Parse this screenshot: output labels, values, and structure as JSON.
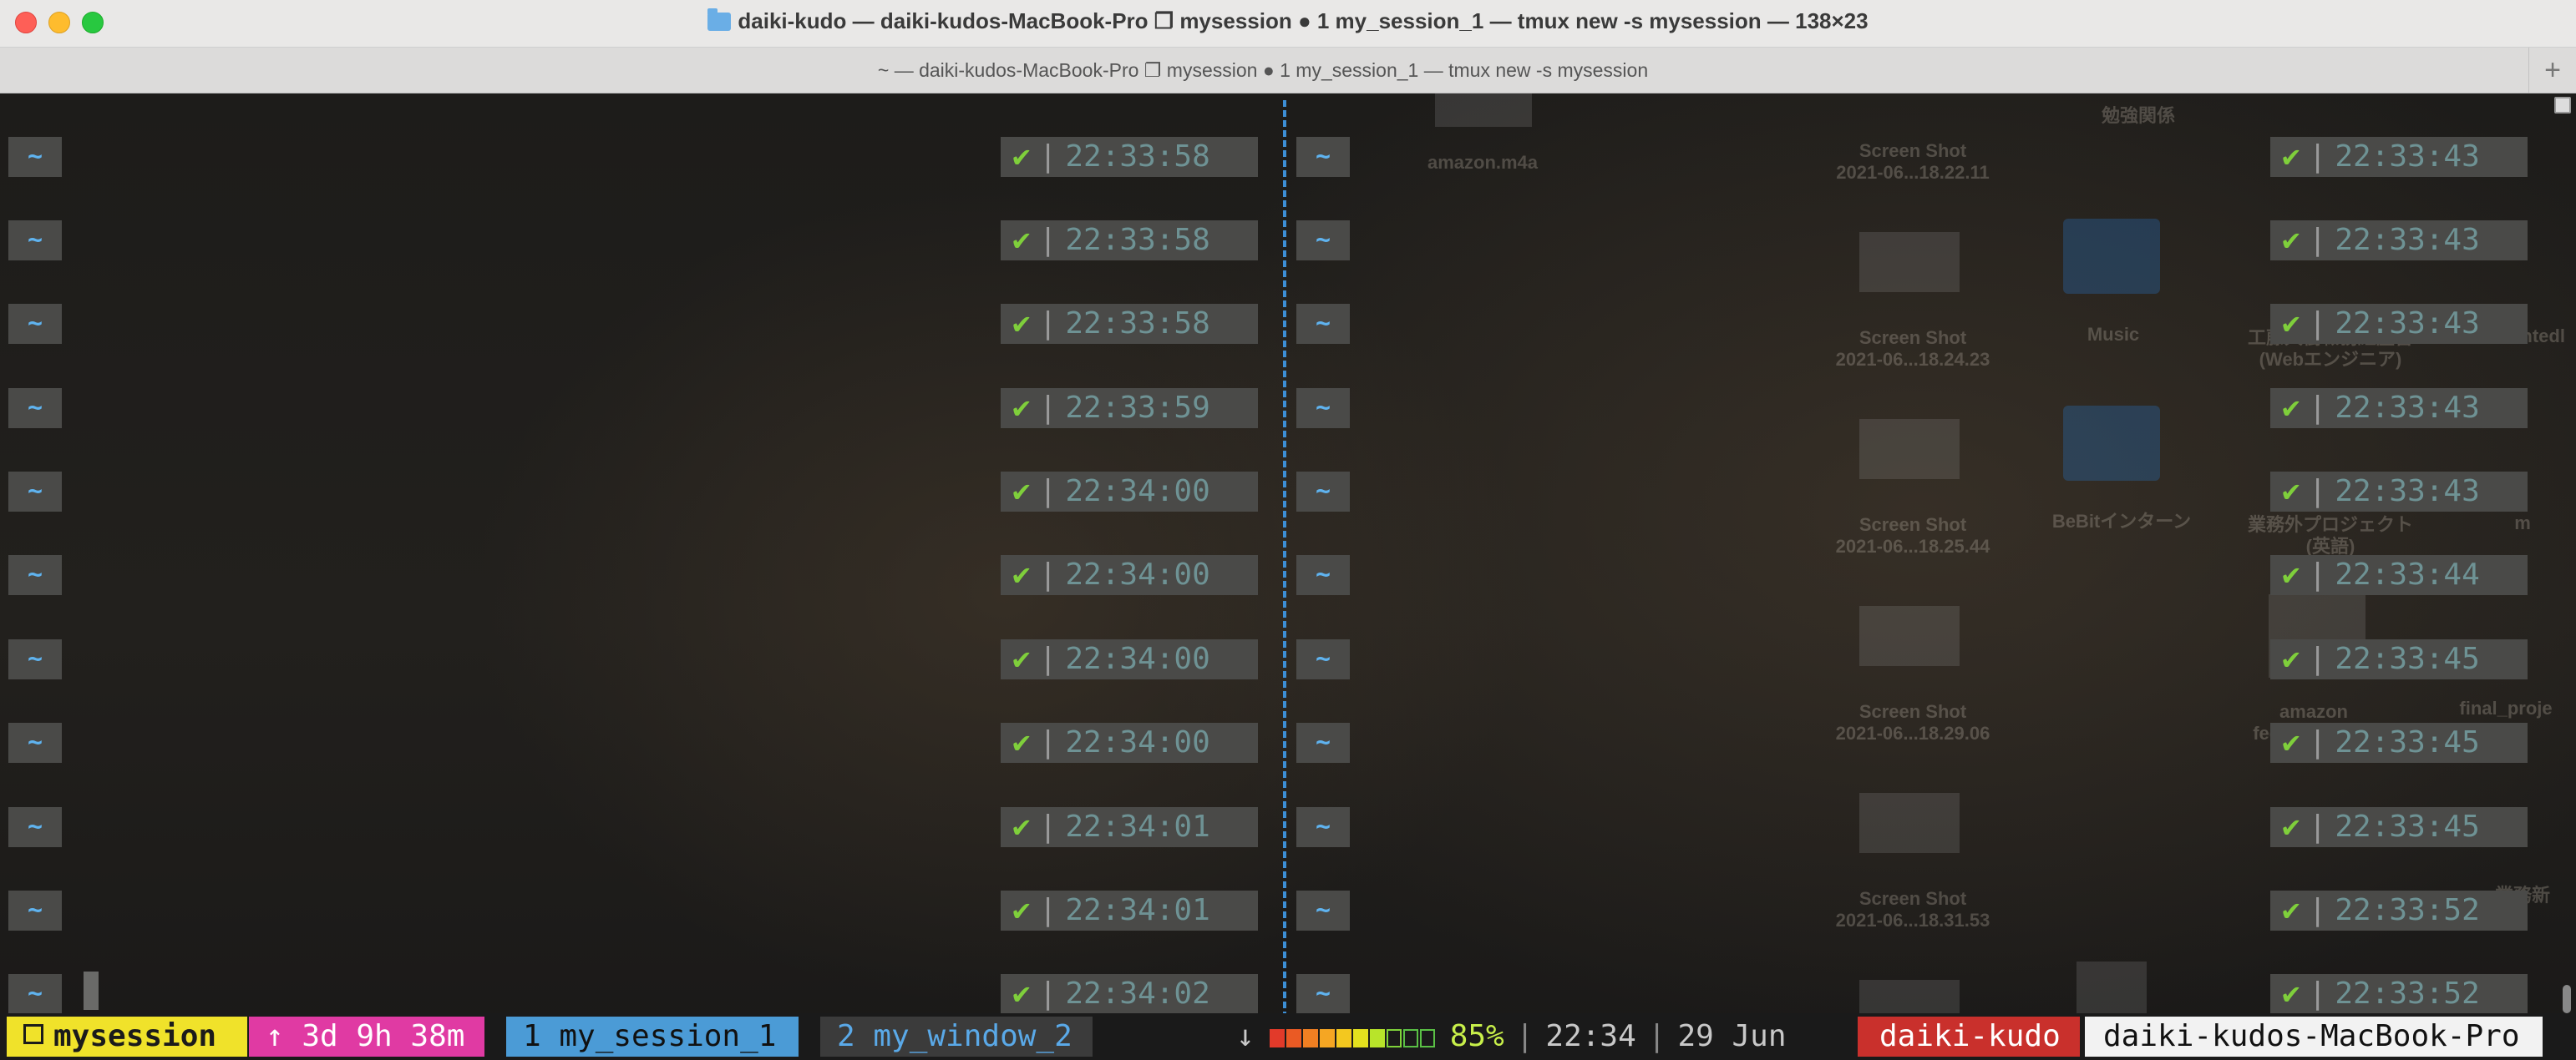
{
  "window": {
    "title": "daiki-kudo — daiki-kudos-MacBook-Pro ❐ mysession ● 1 my_session_1 — tmux new -s mysession — 138×23",
    "tab_title": "~ — daiki-kudos-MacBook-Pro ❐ mysession ● 1 my_session_1 — tmux new -s mysession",
    "new_tab_label": "+"
  },
  "desktop_items": [
    {
      "label": "amazon.m4a"
    },
    {
      "label": "勉強関係"
    },
    {
      "label": "Screen Shot\n2021-06...18.22.11"
    },
    {
      "label": "Screen Shot\n2021-06...18.24.23"
    },
    {
      "label": "Music"
    },
    {
      "label": "工藤大樹職務経歴書\n(Webエンジニア)"
    },
    {
      "label": "wantedl"
    },
    {
      "label": "Screen Shot\n2021-06...18.25.44"
    },
    {
      "label": "BeBitインターン"
    },
    {
      "label": "業務外プロジェクト\n(英語)"
    },
    {
      "label": "m"
    },
    {
      "label": "Screen Shot\n2021-06...18.29.06"
    },
    {
      "label": "amazon\nfeedback.m4a"
    },
    {
      "label": "final_proje"
    },
    {
      "label": "Screen Shot\n2021-06...18.31.53"
    },
    {
      "label": "業務新"
    }
  ],
  "left_pane": {
    "prompts": [
      {
        "dir": "~",
        "check": "✔",
        "time": "22:33:58"
      },
      {
        "dir": "~",
        "check": "✔",
        "time": "22:33:58"
      },
      {
        "dir": "~",
        "check": "✔",
        "time": "22:33:58"
      },
      {
        "dir": "~",
        "check": "✔",
        "time": "22:33:59"
      },
      {
        "dir": "~",
        "check": "✔",
        "time": "22:34:00"
      },
      {
        "dir": "~",
        "check": "✔",
        "time": "22:34:00"
      },
      {
        "dir": "~",
        "check": "✔",
        "time": "22:34:00"
      },
      {
        "dir": "~",
        "check": "✔",
        "time": "22:34:00"
      },
      {
        "dir": "~",
        "check": "✔",
        "time": "22:34:01"
      },
      {
        "dir": "~",
        "check": "✔",
        "time": "22:34:01"
      },
      {
        "dir": "~",
        "check": "✔",
        "time": "22:34:02"
      }
    ]
  },
  "right_pane": {
    "prompts": [
      {
        "dir": "~",
        "check": "✔",
        "time": "22:33:43"
      },
      {
        "dir": "~",
        "check": "✔",
        "time": "22:33:43"
      },
      {
        "dir": "~",
        "check": "✔",
        "time": "22:33:43"
      },
      {
        "dir": "~",
        "check": "✔",
        "time": "22:33:43"
      },
      {
        "dir": "~",
        "check": "✔",
        "time": "22:33:43"
      },
      {
        "dir": "~",
        "check": "✔",
        "time": "22:33:44"
      },
      {
        "dir": "~",
        "check": "✔",
        "time": "22:33:45"
      },
      {
        "dir": "~",
        "check": "✔",
        "time": "22:33:45"
      },
      {
        "dir": "~",
        "check": "✔",
        "time": "22:33:45"
      },
      {
        "dir": "~",
        "check": "✔",
        "time": "22:33:52"
      },
      {
        "dir": "~",
        "check": "✔",
        "time": "22:33:52"
      }
    ]
  },
  "statusbar": {
    "session": "mysession",
    "uptime": "↑ 3d 9h 38m",
    "window_1": "1 my_session_1",
    "window_2": "2 my_window_2",
    "arrow": "↓",
    "battery_percent": 85,
    "battery_label": "85%",
    "battery_colors": [
      "#e23a2a",
      "#ea5a24",
      "#f07f22",
      "#f5a623",
      "#f3c81f",
      "#e4e21e",
      "#b8e42a",
      "#7fd23a",
      "#5ac045",
      "#5ac045"
    ],
    "separator": "|",
    "time": "22:34",
    "date": "29 Jun",
    "user": "daiki-kudo",
    "host": "daiki-kudos-MacBook-Pro"
  }
}
